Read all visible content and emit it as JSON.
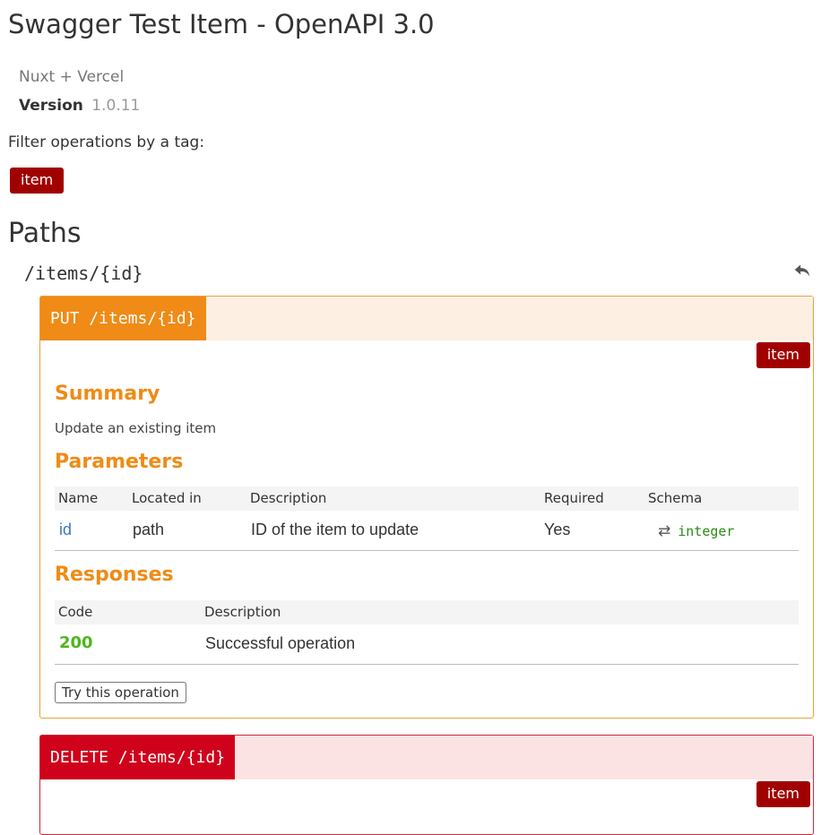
{
  "header": {
    "title": "Swagger Test Item - OpenAPI 3.0",
    "subtitle": "Nuxt + Vercel",
    "version_label": "Version",
    "version_value": "1.0.11"
  },
  "filter": {
    "label": "Filter operations by a tag:",
    "tags": [
      "item"
    ]
  },
  "paths": {
    "title": "Paths",
    "path": "/items/{id}",
    "back_icon": "reply-icon",
    "operations": [
      {
        "method_path": "PUT /items/{id}",
        "tag": "item",
        "summary_heading": "Summary",
        "summary": "Update an existing item",
        "parameters_heading": "Parameters",
        "parameter_columns": [
          "Name",
          "Located in",
          "Description",
          "Required",
          "Schema"
        ],
        "parameters": [
          {
            "name": "id",
            "located_in": "path",
            "description": "ID of the item to update",
            "required": "Yes",
            "schema": "integer",
            "schema_icon": "swap-icon"
          }
        ],
        "responses_heading": "Responses",
        "response_columns": [
          "Code",
          "Description"
        ],
        "responses": [
          {
            "code": "200",
            "description": "Successful operation"
          }
        ],
        "try_label": "Try this operation"
      },
      {
        "method_path": "DELETE /items/{id}",
        "tag": "item"
      }
    ]
  },
  "colors": {
    "tag": "#a10000",
    "put": "#ef8b16",
    "put_bg": "#fdf0e2",
    "delete": "#d0021b",
    "delete_bg": "#fbe3e4",
    "success_code": "#4cb51c",
    "link": "#3a7bbf",
    "schema": "#2a8a1a"
  }
}
